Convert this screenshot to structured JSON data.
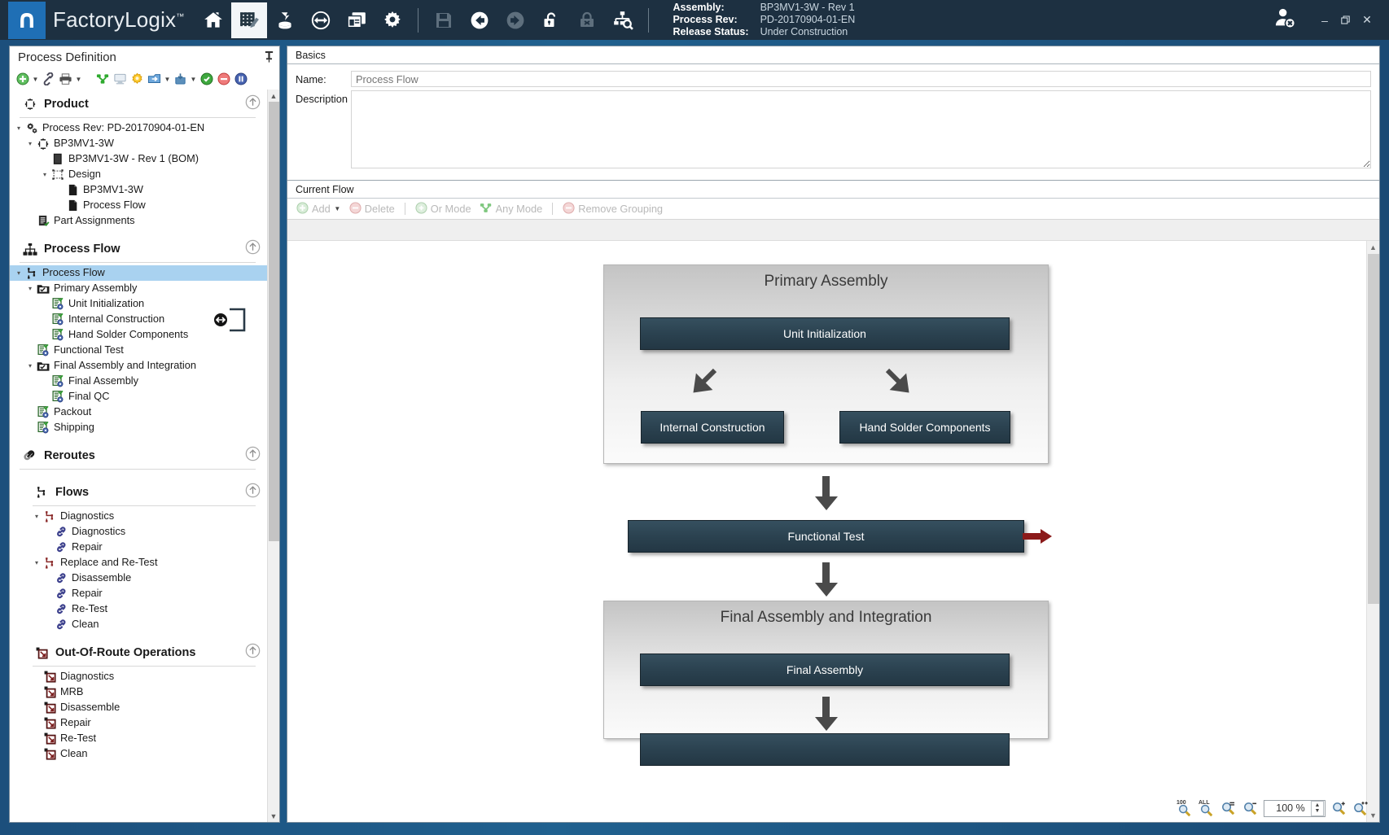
{
  "app": {
    "brand": "FactoryLogix",
    "trademark": "™"
  },
  "titlebar": {
    "icons": [
      {
        "name": "home-icon",
        "label": "Home"
      },
      {
        "name": "grid-edit-icon",
        "label": "Process Definition"
      },
      {
        "name": "database-import-icon",
        "label": "Data Import"
      },
      {
        "name": "transfer-icon",
        "label": "Transfer"
      },
      {
        "name": "windows-icon",
        "label": "Windows"
      },
      {
        "name": "gear-icon",
        "label": "Settings"
      },
      {
        "name": "save-icon",
        "label": "Save"
      },
      {
        "name": "back-icon",
        "label": "Back"
      },
      {
        "name": "forward-icon",
        "label": "Forward"
      },
      {
        "name": "unlock-icon",
        "label": "Unlock"
      },
      {
        "name": "lock-x-icon",
        "label": "Locked"
      },
      {
        "name": "inspect-icon",
        "label": "Inspect"
      }
    ],
    "meta": {
      "assembly_label": "Assembly:",
      "assembly_value": "BP3MV1-3W  - Rev 1",
      "process_rev_label": "Process Rev:",
      "process_rev_value": "PD-20170904-01-EN",
      "release_status_label": "Release Status:",
      "release_status_value": "Under Construction"
    },
    "window": {
      "user_icon": "user-logout-icon",
      "minimize": "–",
      "restore": "❐",
      "close": "✕"
    }
  },
  "left_panel": {
    "title": "Process Definition",
    "pin_icon": "pin-icon",
    "toolbar": [
      {
        "name": "add-button",
        "icon": "add-green-icon"
      },
      {
        "name": "add-dropdown",
        "icon": "chevron-down-icon"
      },
      {
        "name": "link-button",
        "icon": "link-icon"
      },
      {
        "name": "print-button",
        "icon": "printer-icon"
      },
      {
        "name": "print-dropdown",
        "icon": "chevron-down-icon"
      },
      {
        "name": "process-button",
        "icon": "process-green-icon"
      },
      {
        "name": "monitor-button",
        "icon": "monitor-icon"
      },
      {
        "name": "settings-button",
        "icon": "yellow-gear-icon"
      },
      {
        "name": "export-button",
        "icon": "export-icon"
      },
      {
        "name": "export-dropdown",
        "icon": "chevron-down-icon"
      },
      {
        "name": "import-button",
        "icon": "import-icon"
      },
      {
        "name": "import-dropdown",
        "icon": "chevron-down-icon"
      },
      {
        "name": "release-button",
        "icon": "release-green-icon"
      },
      {
        "name": "stop-button",
        "icon": "stop-red-icon"
      },
      {
        "name": "pause-button",
        "icon": "pause-blue-icon"
      }
    ],
    "sections": [
      {
        "title": "Product",
        "icon": "product-cube-icon",
        "collapse_icon": "collapse-up-icon",
        "items": [
          {
            "label": "Process Rev: PD-20170904-01-EN",
            "indent": 0,
            "icon": "gears-icon",
            "expander": "expanded"
          },
          {
            "label": "BP3MV1-3W",
            "indent": 1,
            "icon": "product-cube-icon",
            "expander": "expanded"
          },
          {
            "label": "BP3MV1-3W  - Rev 1 (BOM)",
            "indent": 2,
            "icon": "bom-icon",
            "expander": "none"
          },
          {
            "label": "Design",
            "indent": 2,
            "icon": "design-icon",
            "expander": "expanded"
          },
          {
            "label": "BP3MV1-3W",
            "indent": 3,
            "icon": "document-icon",
            "expander": "none"
          },
          {
            "label": "Process Flow",
            "indent": 3,
            "icon": "document-icon",
            "expander": "none"
          },
          {
            "label": "Part Assignments",
            "indent": 1,
            "icon": "part-assignments-icon",
            "expander": "none"
          }
        ]
      },
      {
        "title": "Process Flow",
        "icon": "process-flow-icon",
        "collapse_icon": "collapse-up-icon",
        "items": [
          {
            "label": "Process Flow",
            "indent": 0,
            "icon": "flow-icon",
            "expander": "expanded",
            "selected": true
          },
          {
            "label": "Primary Assembly",
            "indent": 1,
            "icon": "folder-check-icon",
            "expander": "expanded"
          },
          {
            "label": "Unit Initialization",
            "indent": 2,
            "icon": "operation-icon",
            "expander": "none"
          },
          {
            "label": "Internal Construction",
            "indent": 2,
            "icon": "operation-icon",
            "expander": "none",
            "or_mark": true
          },
          {
            "label": "Hand Solder Components",
            "indent": 2,
            "icon": "operation-icon",
            "expander": "none"
          },
          {
            "label": "Functional Test",
            "indent": 1,
            "icon": "operation-icon",
            "expander": "none"
          },
          {
            "label": "Final Assembly and Integration",
            "indent": 1,
            "icon": "folder-check-icon",
            "expander": "expanded"
          },
          {
            "label": "Final Assembly",
            "indent": 2,
            "icon": "operation-icon",
            "expander": "none"
          },
          {
            "label": "Final QC",
            "indent": 2,
            "icon": "operation-icon",
            "expander": "none"
          },
          {
            "label": "Packout",
            "indent": 1,
            "icon": "operation-icon",
            "expander": "none"
          },
          {
            "label": "Shipping",
            "indent": 1,
            "icon": "operation-icon",
            "expander": "none"
          }
        ]
      },
      {
        "title": "Reroutes",
        "icon": "reroutes-icon",
        "collapse_icon": "collapse-up-icon",
        "items": []
      },
      {
        "title": "Flows",
        "icon": "flow-icon",
        "collapse_icon": "collapse-up-icon",
        "indented": true,
        "items": [
          {
            "label": "Diagnostics",
            "indent": 0,
            "icon": "flow-red-icon",
            "expander": "expanded"
          },
          {
            "label": "Diagnostics",
            "indent": 1,
            "icon": "chain-icon",
            "expander": "none"
          },
          {
            "label": "Repair",
            "indent": 1,
            "icon": "chain-icon",
            "expander": "none"
          },
          {
            "label": "Replace and Re-Test",
            "indent": 0,
            "icon": "flow-red-icon",
            "expander": "expanded"
          },
          {
            "label": "Disassemble",
            "indent": 1,
            "icon": "chain-icon",
            "expander": "none"
          },
          {
            "label": "Repair",
            "indent": 1,
            "icon": "chain-icon",
            "expander": "none"
          },
          {
            "label": "Re-Test",
            "indent": 1,
            "icon": "chain-icon",
            "expander": "none"
          },
          {
            "label": "Clean",
            "indent": 1,
            "icon": "chain-icon",
            "expander": "none"
          }
        ]
      },
      {
        "title": "Out-Of-Route Operations",
        "icon": "out-of-route-icon",
        "collapse_icon": "collapse-up-icon",
        "indented": true,
        "items": [
          {
            "label": "Diagnostics",
            "indent": 0,
            "icon": "out-of-route-icon",
            "expander": "none"
          },
          {
            "label": "MRB",
            "indent": 0,
            "icon": "out-of-route-icon",
            "expander": "none"
          },
          {
            "label": "Disassemble",
            "indent": 0,
            "icon": "out-of-route-icon",
            "expander": "none"
          },
          {
            "label": "Repair",
            "indent": 0,
            "icon": "out-of-route-icon",
            "expander": "none"
          },
          {
            "label": "Re-Test",
            "indent": 0,
            "icon": "out-of-route-icon",
            "expander": "none"
          },
          {
            "label": "Clean",
            "indent": 0,
            "icon": "out-of-route-icon",
            "expander": "none"
          }
        ]
      }
    ]
  },
  "basics": {
    "panel_title": "Basics",
    "name_label": "Name:",
    "name_value": "",
    "name_placeholder": "Process Flow",
    "description_label": "Description",
    "description_value": "",
    "description_placeholder": ""
  },
  "current_flow": {
    "panel_title": "Current Flow",
    "toolbar": [
      {
        "name": "add-button",
        "label": "Add",
        "icon": "add-green-icon",
        "has_dropdown": true,
        "disabled": true
      },
      {
        "name": "delete-button",
        "label": "Delete",
        "icon": "delete-red-icon",
        "disabled": true
      },
      {
        "name": "or-mode-button",
        "label": "Or Mode",
        "icon": "or-mode-icon",
        "disabled": true
      },
      {
        "name": "any-mode-button",
        "label": "Any Mode",
        "icon": "any-mode-icon",
        "disabled": true
      },
      {
        "name": "remove-grouping-button",
        "label": "Remove Grouping",
        "icon": "delete-red-icon",
        "disabled": true
      }
    ]
  },
  "flow_diagram": {
    "groups": [
      {
        "name": "primary-assembly-group",
        "title": "Primary Assembly",
        "operations": [
          {
            "label": "Unit Initialization"
          },
          {
            "label": "Internal Construction"
          },
          {
            "label": "Hand Solder Components"
          }
        ]
      },
      {
        "name": "final-assembly-group",
        "title": "Final Assembly and Integration",
        "operations": [
          {
            "label": "Final Assembly"
          }
        ]
      }
    ],
    "standalone_operations": [
      {
        "label": "Functional Test",
        "has_reroute": true
      }
    ]
  },
  "zoom_bar": {
    "fit_100_icon": "zoom-100-icon",
    "fit_100_label": "100",
    "fit_all_icon": "zoom-all-icon",
    "fit_all_label": "ALL",
    "zoom_out_much_icon": "zoom-out-much-icon",
    "zoom_out_icon": "zoom-out-icon",
    "zoom_value": "100 %",
    "zoom_in_icon": "zoom-in-icon",
    "zoom_in_much_icon": "zoom-in-much-icon"
  },
  "colors": {
    "brand_blue": "#1f6fb5",
    "titlebar_dark": "#1d3041",
    "selection_blue": "#a9d2f0",
    "operation_box": "#2b4250",
    "reroute_arrow_red": "#8b1a1a",
    "window_frame": "#20618f"
  }
}
